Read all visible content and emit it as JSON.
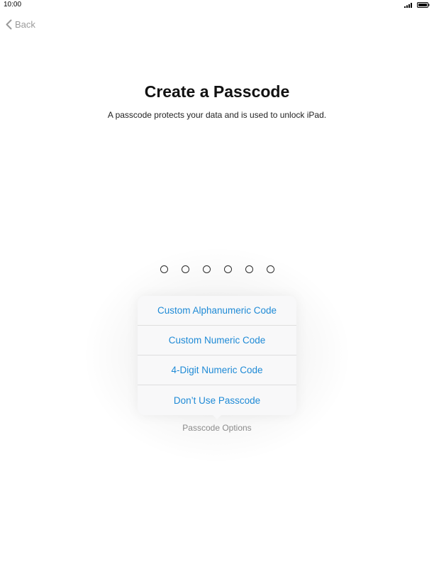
{
  "status_bar": {
    "time": "10:00"
  },
  "nav": {
    "back_label": "Back"
  },
  "header": {
    "title": "Create a Passcode",
    "subtitle": "A passcode protects your data and is used to unlock iPad."
  },
  "passcode": {
    "digits": 6,
    "entered": 0
  },
  "options_menu": {
    "items": [
      {
        "label": "Custom Alphanumeric Code"
      },
      {
        "label": "Custom Numeric Code"
      },
      {
        "label": "4-Digit Numeric Code"
      },
      {
        "label": "Don’t Use Passcode"
      }
    ],
    "trigger_label": "Passcode Options"
  },
  "colors": {
    "accent": "#1e8ad6",
    "muted": "#8a8a8a"
  }
}
